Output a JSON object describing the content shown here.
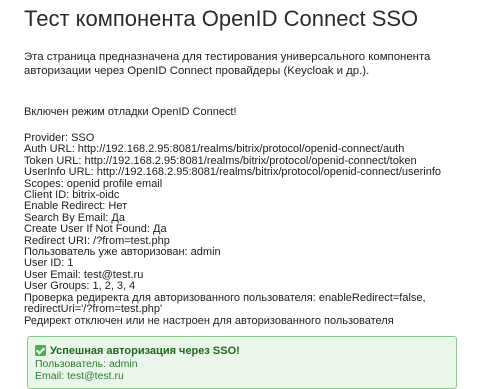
{
  "page": {
    "title": "Тест компонента OpenID Connect SSO",
    "intro": "Эта страница предназначена для тестирования универсального компонента авторизации через OpenID Connect провайдеры (Keycloak  и др.).",
    "debug_notice": "Включен режим отладки OpenID Connect!"
  },
  "details": [
    "Provider: SSO",
    "Auth URL: http://192.168.2.95:8081/realms/bitrix/protocol/openid-connect/auth",
    "Token URL: http://192.168.2.95:8081/realms/bitrix/protocol/openid-connect/token",
    "UserInfo URL: http://192.168.2.95:8081/realms/bitrix/protocol/openid-connect/userinfo",
    "Scopes: openid profile email",
    "Client ID: bitrix-oidc",
    "Enable Redirect: Нет",
    "Search By Email: Да",
    "Create User If Not Found: Да",
    "Redirect URI: /?from=test.php",
    "Пользователь уже авторизован: admin",
    "User ID: 1",
    "User Email: test@test.ru",
    "User Groups: 1, 2, 3, 4",
    "Проверка редиректа для авторизованного пользователя: enableRedirect=false, redirectUri='/?from=test.php'",
    "Редирект отключен или не настроен для авторизованного пользователя"
  ],
  "success": {
    "icon": "check-icon",
    "icon_color": "#4caf50",
    "heading": "Успешная авторизация через SSO!",
    "user_line": "Пользователь: admin",
    "email_line": "Email: test@test.ru",
    "background": "#e9f6e9",
    "border": "#8cc98c"
  }
}
